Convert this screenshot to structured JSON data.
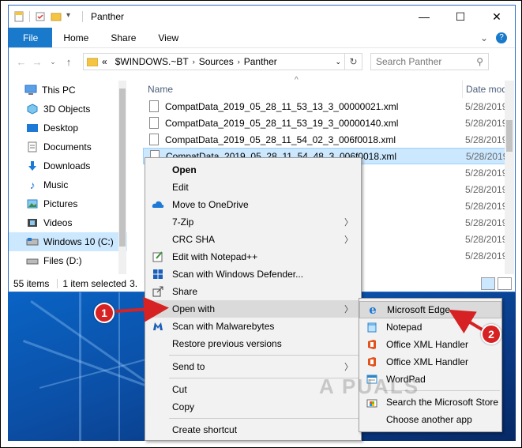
{
  "window": {
    "title": "Panther"
  },
  "ribbon": {
    "tabs": [
      "File",
      "Home",
      "Share",
      "View"
    ]
  },
  "address": {
    "prefix": "«",
    "crumbs": [
      "$WINDOWS.~BT",
      "Sources",
      "Panther"
    ],
    "search_placeholder": "Search Panther"
  },
  "nav": {
    "items": [
      {
        "label": "This PC",
        "icon": "computer-icon"
      },
      {
        "label": "3D Objects",
        "icon": "cube-icon"
      },
      {
        "label": "Desktop",
        "icon": "desktop-icon"
      },
      {
        "label": "Documents",
        "icon": "document-icon"
      },
      {
        "label": "Downloads",
        "icon": "download-arrow-icon"
      },
      {
        "label": "Music",
        "icon": "music-note-icon"
      },
      {
        "label": "Pictures",
        "icon": "picture-icon"
      },
      {
        "label": "Videos",
        "icon": "film-icon"
      },
      {
        "label": "Windows 10 (C:)",
        "icon": "drive-icon"
      },
      {
        "label": "Files (D:)",
        "icon": "drive-icon"
      }
    ]
  },
  "filelist": {
    "col_name": "Name",
    "col_date": "Date mod",
    "rows": [
      {
        "name": "CompatData_2019_05_28_11_53_13_3_00000021.xml",
        "date": "5/28/2019"
      },
      {
        "name": "CompatData_2019_05_28_11_53_19_3_00000140.xml",
        "date": "5/28/2019"
      },
      {
        "name": "CompatData_2019_05_28_11_54_02_3_006f0018.xml",
        "date": "5/28/2019"
      },
      {
        "name": "CompatData_2019_05_28_11_54_48_3_006f0018.xml",
        "date": "5/28/2019"
      },
      {
        "name": "",
        "date": "5/28/2019"
      },
      {
        "name": "",
        "date": "5/28/2019"
      },
      {
        "name": "",
        "date": "5/28/2019"
      },
      {
        "name": "",
        "date": "5/28/2019"
      },
      {
        "name": "",
        "date": "5/28/2019"
      },
      {
        "name": "",
        "date": "5/28/2019"
      }
    ]
  },
  "status": {
    "count": "55 items",
    "selected": "1 item selected",
    "size": "3."
  },
  "context_menu": {
    "items": [
      "Open",
      "Edit",
      "Move to OneDrive",
      "7-Zip",
      "CRC SHA",
      "Edit with Notepad++",
      "Scan with Windows Defender...",
      "Share",
      "Open with",
      "Scan with Malwarebytes",
      "Restore previous versions",
      "Send to",
      "Cut",
      "Copy",
      "Create shortcut"
    ]
  },
  "open_with_menu": {
    "items": [
      "Microsoft Edge",
      "Notepad",
      "Office XML Handler",
      "Office XML Handler",
      "WordPad",
      "Search the Microsoft Store",
      "Choose another app"
    ]
  },
  "callouts": {
    "one": "1",
    "two": "2"
  },
  "watermark": "A PUALS",
  "colors": {
    "accent": "#1979ca",
    "selection": "#cce8ff",
    "callout": "#d62222"
  }
}
